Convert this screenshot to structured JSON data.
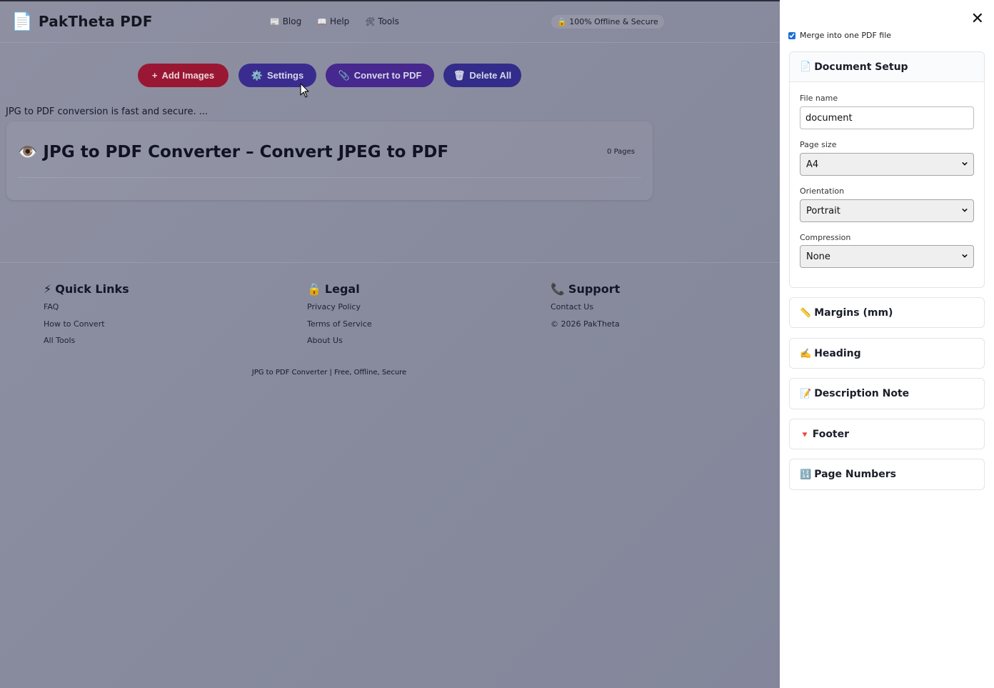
{
  "header": {
    "brand_icon": "document-icon",
    "brand_title": "PakTheta PDF",
    "nav": [
      {
        "icon": "newspaper-icon",
        "glyph": "📰",
        "label": "Blog"
      },
      {
        "icon": "book-icon",
        "glyph": "📖",
        "label": "Help"
      },
      {
        "icon": "tools-icon",
        "glyph": "🛠",
        "label": "Tools"
      }
    ],
    "secure_badge": "🔒 100% Offline & Secure"
  },
  "toolbar": {
    "add_label": "Add Images",
    "settings_label": "Settings",
    "convert_label": "Convert to PDF",
    "delete_label": "Delete All"
  },
  "intro_text": "JPG to PDF conversion is fast and secure. ...",
  "card": {
    "title": "JPG to PDF Converter – Convert JPEG to PDF",
    "pages_count": "0 Pages"
  },
  "footer": {
    "quick": {
      "title": "Quick Links",
      "links": [
        "FAQ",
        "How to Convert",
        "All Tools"
      ]
    },
    "legal": {
      "title": "Legal",
      "links": [
        "Privacy Policy",
        "Terms of Service",
        "About Us"
      ]
    },
    "support": {
      "title": "Support",
      "items": [
        "Contact Us",
        "© 2026 PakTheta"
      ]
    },
    "bottom": "JPG to PDF Converter | Free, Offline, Secure"
  },
  "panel": {
    "merge_label": "Merge into one PDF file",
    "merge_checked": true,
    "doc_setup": {
      "title": "Document Setup",
      "file_name_label": "File name",
      "file_name_value": "document",
      "page_size_label": "Page size",
      "page_size_value": "A4",
      "orientation_label": "Orientation",
      "orientation_value": "Portrait",
      "compression_label": "Compression",
      "compression_value": "None"
    },
    "sections": {
      "margins": "Margins (mm)",
      "heading": "Heading",
      "description": "Description Note",
      "footer": "Footer",
      "page_numbers": "Page Numbers"
    }
  },
  "colors": {
    "overlay": "#8a8c9e",
    "add_button": "#9a1733",
    "settings_button": "#3a2b8f",
    "convert_button": "#46288f",
    "delete_button": "#332c8a",
    "checkbox_accent": "#1a6ed8"
  }
}
